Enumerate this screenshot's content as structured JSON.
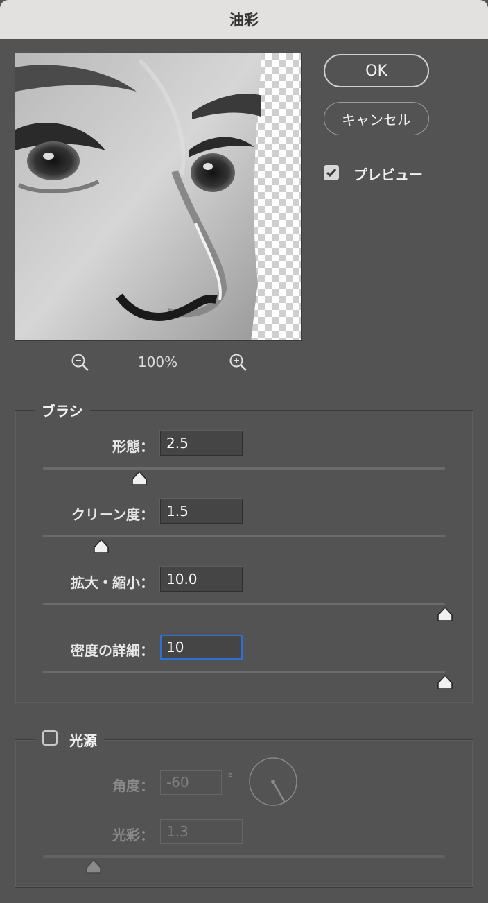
{
  "dialog": {
    "title": "油彩"
  },
  "buttons": {
    "ok": "OK",
    "cancel": "キャンセル"
  },
  "preview_toggle": {
    "label": "プレビュー",
    "checked": true
  },
  "zoom": {
    "level": "100%",
    "zoom_out_icon": "zoom-out-icon",
    "zoom_in_icon": "zoom-in-icon"
  },
  "brush": {
    "legend": "ブラシ",
    "params": [
      {
        "label": "形態：",
        "value": "2.5",
        "slider_fraction": 0.24
      },
      {
        "label": "クリーン度：",
        "value": "1.5",
        "slider_fraction": 0.145
      },
      {
        "label": "拡大・縮小：",
        "value": "10.0",
        "slider_fraction": 1.0
      },
      {
        "label": "密度の詳細：",
        "value": "10",
        "slider_fraction": 1.0
      }
    ]
  },
  "lighting": {
    "legend": "光源",
    "enabled": false,
    "angle_label": "角度：",
    "angle_value": "-60",
    "angle_unit": "°",
    "shine_label": "光彩：",
    "shine_value": "1.3",
    "shine_slider_fraction": 0.125
  },
  "colors": {
    "background": "#535353",
    "titlebar": "#e3e0e0",
    "focus": "#2d6fd3"
  }
}
